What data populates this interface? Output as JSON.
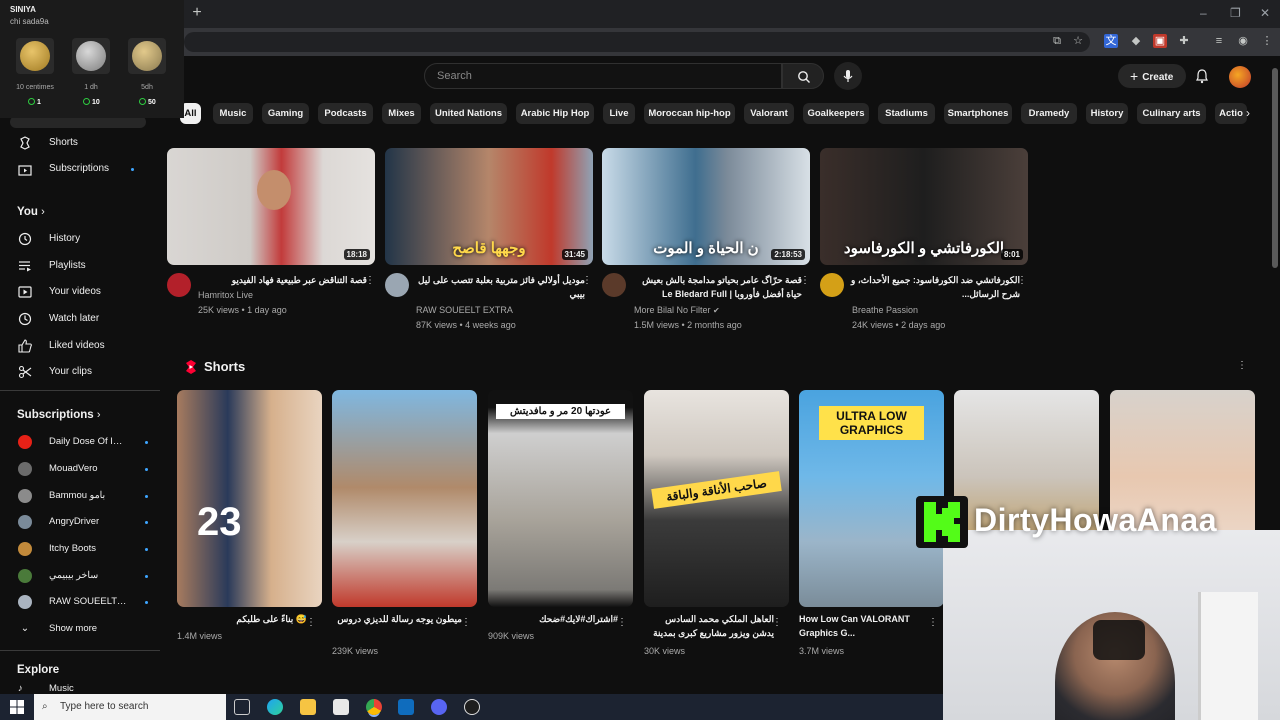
{
  "overlay": {
    "title": "SINIYA",
    "subtitle": "chi sada9a",
    "coins": [
      {
        "label": "10 centimes",
        "count": "1"
      },
      {
        "label": "1 dh",
        "count": "10"
      },
      {
        "label": "5dh",
        "count": "50"
      }
    ]
  },
  "header": {
    "search_placeholder": "Search",
    "create_label": "Create"
  },
  "chips": [
    "All",
    "Music",
    "Gaming",
    "Podcasts",
    "Mixes",
    "United Nations",
    "Arabic Hip Hop",
    "Live",
    "Moroccan hip-hop",
    "Valorant",
    "Goalkeepers",
    "Stadiums",
    "Smartphones",
    "Dramedy",
    "History",
    "Culinary arts",
    "Actio"
  ],
  "sidebar": {
    "top_items": [
      {
        "label": "Shorts",
        "icon": "shorts-icon"
      },
      {
        "label": "Subscriptions",
        "icon": "subscriptions-icon"
      }
    ],
    "you_heading": "You",
    "you_items": [
      {
        "label": "History",
        "icon": "history-icon"
      },
      {
        "label": "Playlists",
        "icon": "playlists-icon"
      },
      {
        "label": "Your videos",
        "icon": "your-videos-icon"
      },
      {
        "label": "Watch later",
        "icon": "watch-later-icon"
      },
      {
        "label": "Liked videos",
        "icon": "liked-videos-icon"
      },
      {
        "label": "Your clips",
        "icon": "clips-icon"
      }
    ],
    "subs_heading": "Subscriptions",
    "subscriptions": [
      {
        "label": "Daily Dose Of Int...",
        "color": "#e62117"
      },
      {
        "label": "MouadVero",
        "color": "#6b6b6b"
      },
      {
        "label": "Bammou بامو",
        "color": "#8b8b8b"
      },
      {
        "label": "AngryDriver",
        "color": "#7a8a99"
      },
      {
        "label": "Itchy Boots",
        "color": "#c28a3b"
      },
      {
        "label": "ساخر بيبيمي",
        "color": "#4a7a3a"
      },
      {
        "label": "RAW SOUEELT E...",
        "color": "#aab4c0"
      }
    ],
    "show_more": "Show more",
    "explore_heading": "Explore",
    "explore_partial": "Music"
  },
  "videos": [
    {
      "title": "قصة التناقض عبر طبيعية فهاد الفيديو",
      "channel": "Hamritox Live",
      "meta": "25K views • 1 day ago",
      "duration": "18:18",
      "thumb_text": "",
      "avatar_color": "#b3202a"
    },
    {
      "title": "موديل أولالي فائز متربية بعلبة تتصب على ليل بيبي",
      "channel": "RAW SOUEELT EXTRA",
      "meta": "87K views • 4 weeks ago",
      "duration": "31:45",
      "thumb_text": "وجهها قاصح",
      "avatar_color": "#9aa6b2"
    },
    {
      "title": "قصة حرّاگ عامر بحياتو مدامجة بالش بعيش حياة أفضل فأوروبا | Le Bledard Full",
      "channel": "More Bilal No Filter",
      "meta": "1.5M views • 2 months ago",
      "duration": "2:18:53",
      "thumb_text": "ن الحياة و الموت",
      "avatar_color": "#5b3a2a"
    },
    {
      "title": "الكورفاتشي ضد الكورفاسود: جميع الأحداث، و شرح الرسائل...",
      "channel": "Breathe Passion",
      "meta": "24K views • 2 days ago",
      "duration": "8:01",
      "thumb_text": "الكورفاتشي و الكورفاسود",
      "avatar_color": "#d4a017"
    }
  ],
  "shorts_heading": "Shorts",
  "shorts": [
    {
      "caption": "😅 بناءً على طلبكم",
      "views": "1.4M views",
      "overtext": ""
    },
    {
      "caption": "ميطون يوجه رسالة للديزي دروس",
      "views": "239K views",
      "overtext": ""
    },
    {
      "caption": "#اشتراك#لايك#ضحك",
      "views": "909K views",
      "overtext": "عودتها 20 مر و مافديتش"
    },
    {
      "caption": "العاهل الملكي محمد السادس يدشن ويزور مشاريع كبرى بمدينة الدار...",
      "views": "30K views",
      "overtext": "صاحب الأناقة والباقة"
    },
    {
      "caption": "How Low Can VALORANT Graphics G...",
      "views": "3.7M views",
      "overtext": "ULTRA LOW GRAPHICS"
    },
    {
      "caption": "",
      "views": "",
      "overtext": ""
    },
    {
      "caption": "",
      "views": "",
      "overtext": ""
    }
  ],
  "watermark": "DirtyHowaAnaa",
  "taskbar": {
    "search_placeholder": "Type here to search"
  }
}
